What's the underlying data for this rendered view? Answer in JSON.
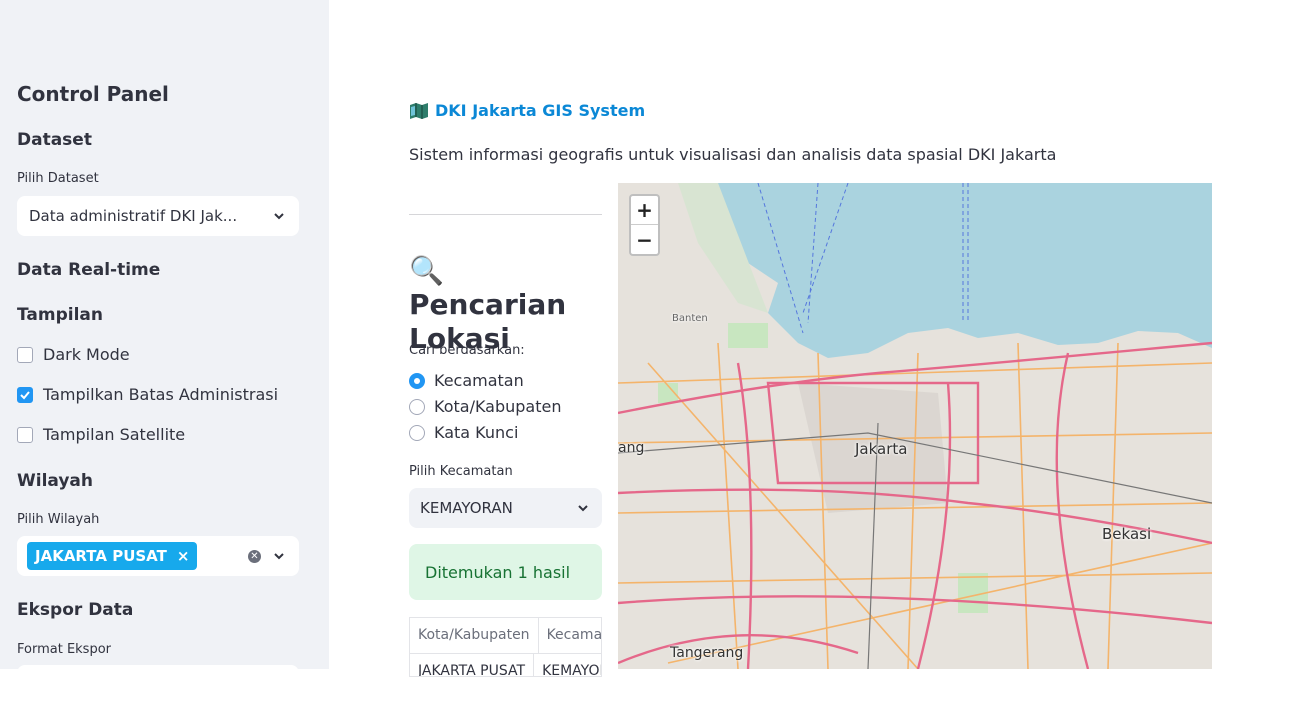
{
  "sidebar": {
    "title": "Control Panel",
    "dataset": {
      "heading": "Dataset",
      "label": "Pilih Dataset",
      "selected": "Data administratif DKI Jak..."
    },
    "realtime": {
      "heading": "Data Real-time"
    },
    "display": {
      "heading": "Tampilan",
      "options": [
        {
          "label": "Dark Mode",
          "checked": false
        },
        {
          "label": "Tampilkan Batas Administrasi",
          "checked": true
        },
        {
          "label": "Tampilan Satellite",
          "checked": false
        }
      ]
    },
    "region": {
      "heading": "Wilayah",
      "label": "Pilih Wilayah",
      "tag": "JAKARTA PUSAT",
      "tag_remove": "×"
    },
    "export": {
      "heading": "Ekspor Data",
      "label": "Format Ekspor"
    }
  },
  "main": {
    "title": "DKI Jakarta GIS System",
    "description": "Sistem informasi geografis untuk visualisasi dan analisis data spasial DKI Jakarta",
    "search": {
      "heading": "🔍 Pencarian Lokasi",
      "radio_label": "Cari berdasarkan:",
      "radio_options": [
        {
          "label": "Kecamatan",
          "selected": true
        },
        {
          "label": "Kota/Kabupaten",
          "selected": false
        },
        {
          "label": "Kata Kunci",
          "selected": false
        }
      ],
      "select_label": "Pilih Kecamatan",
      "select_value": "KEMAYORAN",
      "result": "Ditemukan 1 hasil",
      "table": {
        "headers": [
          "Kota/Kabupaten",
          "Kecamatan"
        ],
        "rows": [
          [
            "JAKARTA PUSAT",
            "KEMAYORAN"
          ]
        ]
      }
    },
    "map": {
      "zoom_in": "+",
      "zoom_out": "−",
      "labels": {
        "jakarta": "Jakarta",
        "bekasi": "Bekasi",
        "tangerang": "Tangerang",
        "banten": "Banten",
        "ang": "ang"
      }
    }
  },
  "colors": {
    "accent": "#2196f3",
    "title_blue": "#0b88d6",
    "sea": "#aad3df",
    "tag": "#17a9ec"
  }
}
